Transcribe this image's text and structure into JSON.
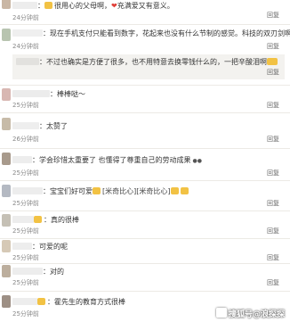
{
  "comments": [
    {
      "text": "很用心的父母啊，",
      "text2": "充满爱又有意义。",
      "time": "24分钟前",
      "reply": "回复"
    },
    {
      "text": "现在手机支付只能看到数字，花起来也没有什么节制的感觉。科技的双刃剑啊",
      "time": "24分钟前",
      "reply": "回复"
    },
    {
      "text": "不过也确实是方便了很多，也不用特意去换零钱什么的，一把辛酸泪啊",
      "reply": "回复"
    },
    {
      "text": "棒棒哒～",
      "time": "25分钟前",
      "reply": "回复"
    },
    {
      "text": "太赞了",
      "time": "26分钟前",
      "reply": "回复"
    },
    {
      "text": "学会珍惜太重要了 也懂得了尊重自己的劳动成果",
      "time": "25分钟前",
      "reply": "回复"
    },
    {
      "text": "宝宝们好可爱",
      "text2": "米奇比心",
      "text3": "米奇比心",
      "time": "25分钟前",
      "reply": "回复"
    },
    {
      "text": "真的很棒",
      "time": "25分钟前",
      "reply": "回复"
    },
    {
      "text": "可爱的呢",
      "time": "25分钟前",
      "reply": "回复"
    },
    {
      "text": "对的",
      "time": "25分钟前",
      "reply": "回复"
    },
    {
      "text": "霍先生的教育方式很棒",
      "time": "25分钟前",
      "reply": "回复"
    }
  ],
  "watermark": "搜狐号@浪探探",
  "colors": {
    "background": "#ffffff",
    "sub_background": "#f3f2ef",
    "heart": "#e0403a"
  }
}
